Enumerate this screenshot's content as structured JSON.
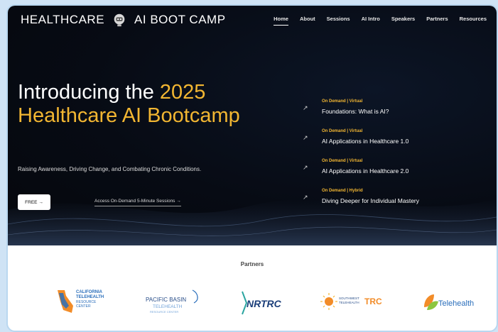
{
  "brand": {
    "left": "HEALTHCARE",
    "right": "AI BOOT CAMP",
    "logo_icon": "robot-head-icon"
  },
  "nav": {
    "items": [
      {
        "label": "Home",
        "active": true
      },
      {
        "label": "About"
      },
      {
        "label": "Sessions"
      },
      {
        "label": "AI Intro"
      },
      {
        "label": "Speakers"
      },
      {
        "label": "Partners"
      },
      {
        "label": "Resources"
      }
    ]
  },
  "hero": {
    "headline_white": "Introducing the ",
    "headline_accent_year": "2025",
    "headline_accent_rest": "Healthcare AI Bootcamp",
    "tagline": "Raising Awareness, Driving Change, and Combating Chronic Conditions.",
    "free_button": "FREE →",
    "on_demand_link": "Access On-Demand 5-Minute Sessions →",
    "accent_color": "#f2b632"
  },
  "sessions": [
    {
      "kind": "On Demand | Virtual",
      "title": "Foundations: What is AI?"
    },
    {
      "kind": "On Demand | Virtual",
      "title": "AI Applications in Healthcare 1.0"
    },
    {
      "kind": "On Demand | Virtual",
      "title": "AI Applications in Healthcare 2.0"
    },
    {
      "kind": "On Demand | Hybrid",
      "title": "Diving Deeper for Individual Mastery"
    }
  ],
  "session_arrow": "↗",
  "partners": {
    "title": "Partners",
    "logos": [
      {
        "lines": [
          "CALIFORNIA",
          "TELEHEALTH",
          "RESOURCE",
          "CENTER"
        ]
      },
      {
        "lines": [
          "PACIFIC BASIN",
          "TELEHEALTH",
          "RESOURCE CENTER"
        ]
      },
      {
        "lines": [
          "NRTRC"
        ]
      },
      {
        "lines": [
          "SOUTHWEST",
          "TELEHEALTH",
          "TRC"
        ]
      },
      {
        "lines": [
          "Telehealth"
        ]
      }
    ]
  }
}
